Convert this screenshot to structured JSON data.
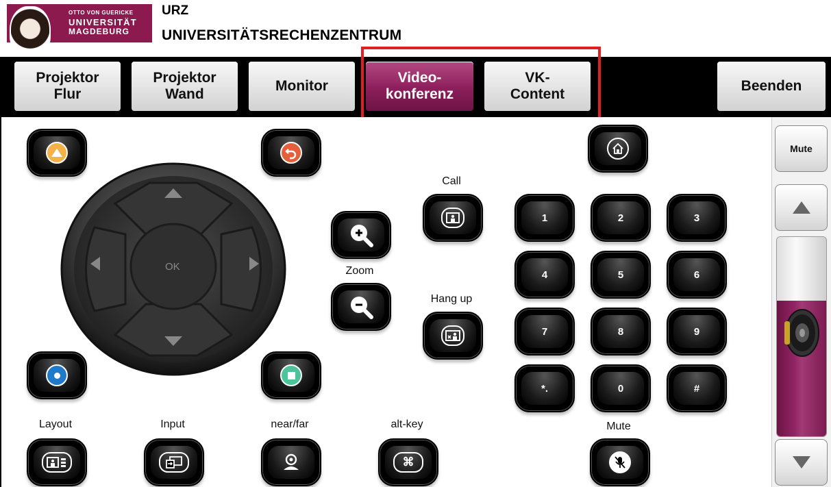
{
  "header": {
    "logo_line1": "OTTO VON GUERICKE",
    "logo_line2": "UNIVERSITÄT",
    "logo_line3": "MAGDEBURG",
    "title_short": "URZ",
    "title_long": "UNIVERSITÄTSRECHENZENTRUM"
  },
  "tabs": {
    "projektor_flur": "Projektor\nFlur",
    "projektor_wand": "Projektor\nWand",
    "monitor": "Monitor",
    "videokonferenz": "Video-\nkonferenz",
    "vk_content": "VK-\nContent",
    "beenden": "Beenden",
    "active": "videokonferenz"
  },
  "dpad": {
    "ok_label": "OK"
  },
  "call": {
    "call_label": "Call",
    "hangup_label": "Hang up"
  },
  "zoom": {
    "label": "Zoom"
  },
  "keypad": [
    "1",
    "2",
    "3",
    "4",
    "5",
    "6",
    "7",
    "8",
    "9",
    "*.",
    "0",
    "#"
  ],
  "bottom": {
    "layout": "Layout",
    "input": "Input",
    "nearfar": "near/far",
    "altkey": "alt-key",
    "mute": "Mute"
  },
  "volume": {
    "mute_label": "Mute",
    "level_fraction": 0.68
  },
  "colors": {
    "accent": "#8c1f5b",
    "highlight": "#e01f24",
    "up_yellow": "#f6b24a",
    "back_orange": "#e5603a",
    "rec_blue": "#1f7ac9",
    "stop_green": "#4dc39a"
  }
}
